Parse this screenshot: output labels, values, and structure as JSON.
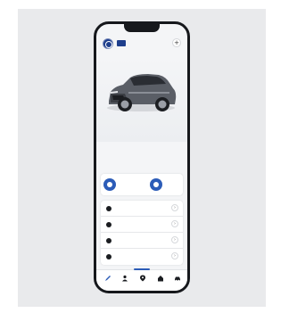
{
  "status_bar": {
    "time": "",
    "icons": ""
  },
  "header": {
    "title": "",
    "action_icon": "plus-icon",
    "brand_color": "#1e3e8c"
  },
  "hero": {
    "subject": "suv-car-image"
  },
  "section": {
    "label": ""
  },
  "quick_card": {
    "items": [
      {
        "icon": "gauge-icon",
        "label": "",
        "value": ""
      },
      {
        "icon": "person-icon",
        "label": "",
        "value": ""
      }
    ]
  },
  "menu": {
    "items": [
      {
        "icon": "key-icon",
        "label": ""
      },
      {
        "icon": "car-icon",
        "label": ""
      },
      {
        "icon": "doc-icon",
        "label": ""
      },
      {
        "icon": "user-icon",
        "label": ""
      }
    ]
  },
  "bottom_nav": {
    "items": [
      {
        "icon": "pen-icon",
        "label": "",
        "active": true
      },
      {
        "icon": "person-icon",
        "label": ""
      },
      {
        "icon": "pin-icon",
        "label": ""
      },
      {
        "icon": "home-icon",
        "label": ""
      },
      {
        "icon": "car-icon",
        "label": ""
      }
    ]
  },
  "colors": {
    "accent": "#2c5cb8",
    "background": "#f4f5f7",
    "frame": "#16181c"
  }
}
